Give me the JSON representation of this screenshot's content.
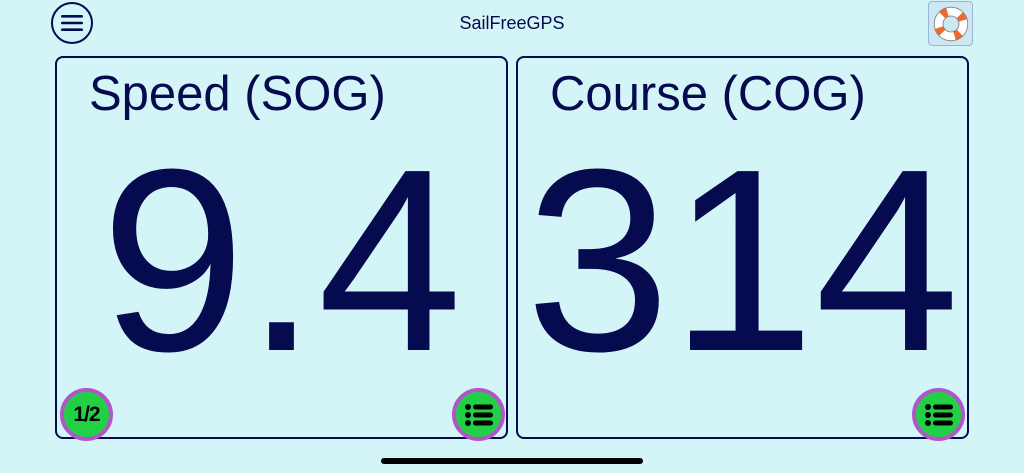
{
  "header": {
    "title": "SailFreeGPS",
    "menu_icon": "hamburger-menu-icon",
    "help_icon": "life-ring-icon"
  },
  "panels": [
    {
      "label": "Speed (SOG)",
      "value": "9.4",
      "bottom_left_label": "1/2",
      "bottom_right_icon": "list-icon"
    },
    {
      "label": "Course (COG)",
      "value": "314",
      "bottom_right_icon": "list-icon"
    }
  ],
  "colors": {
    "background": "#d4f5f7",
    "text": "#060a4e",
    "button_fill": "#22d046",
    "button_ring": "#b156c8"
  }
}
